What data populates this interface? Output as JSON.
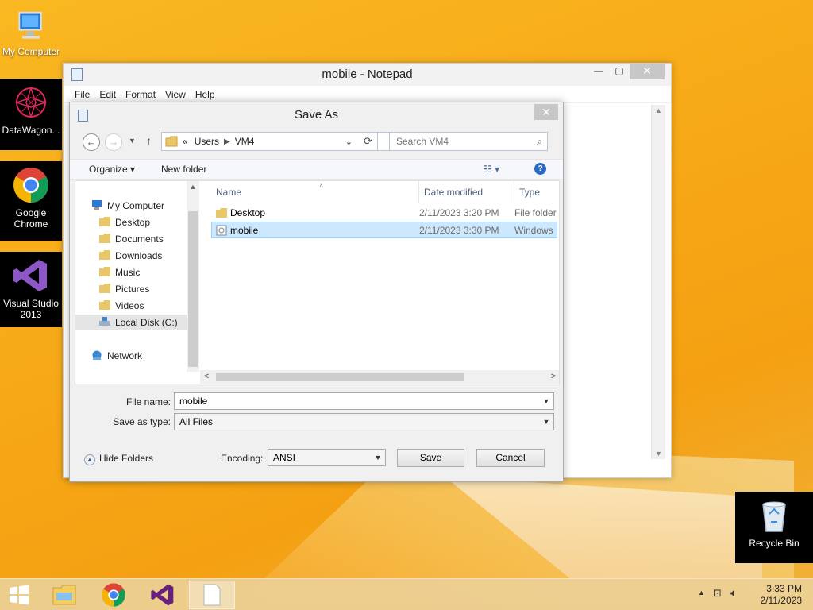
{
  "desktop": {
    "icons": [
      {
        "label": "My Computer"
      },
      {
        "label": "DataWagon..."
      },
      {
        "label": "Google Chrome"
      },
      {
        "label": "Visual Studio 2013"
      },
      {
        "label": "Recycle Bin"
      }
    ]
  },
  "notepad": {
    "title": "mobile - Notepad",
    "menu": [
      "File",
      "Edit",
      "Format",
      "View",
      "Help"
    ]
  },
  "dialog": {
    "title": "Save As",
    "breadcrumb": {
      "prefix": "«",
      "items": [
        "Users",
        "VM4"
      ]
    },
    "search_placeholder": "Search VM4",
    "toolbar": {
      "organize": "Organize",
      "new_folder": "New folder"
    },
    "tree": [
      {
        "label": "My Computer"
      },
      {
        "label": "Desktop"
      },
      {
        "label": "Documents"
      },
      {
        "label": "Downloads"
      },
      {
        "label": "Music"
      },
      {
        "label": "Pictures"
      },
      {
        "label": "Videos"
      },
      {
        "label": "Local Disk (C:)"
      },
      {
        "label": "Network"
      }
    ],
    "columns": {
      "name": "Name",
      "date": "Date modified",
      "type": "Type"
    },
    "files": [
      {
        "name": "Desktop",
        "date": "2/11/2023 3:20 PM",
        "type": "File folder"
      },
      {
        "name": "mobile",
        "date": "2/11/2023 3:30 PM",
        "type": "Windows"
      }
    ],
    "filename_label": "File name:",
    "filename_value": "mobile",
    "savetype_label": "Save as type:",
    "savetype_value": "All Files",
    "hide_folders": "Hide Folders",
    "encoding_label": "Encoding:",
    "encoding_value": "ANSI",
    "save_button": "Save",
    "cancel_button": "Cancel"
  },
  "taskbar": {
    "time": "3:33 PM",
    "date": "2/11/2023"
  },
  "colors": {
    "selection": "#cce8ff",
    "accent": "#0078d7"
  }
}
